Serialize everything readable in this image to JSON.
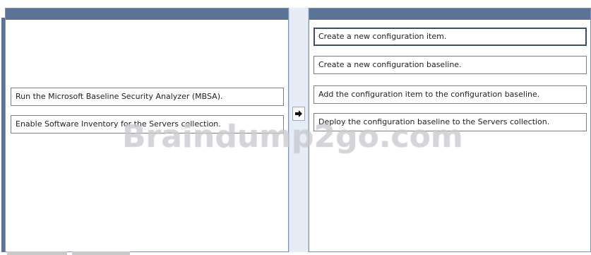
{
  "source_items": [
    "Run the Microsoft Baseline Security Analyzer (MBSA).",
    "Enable Software Inventory for the Servers collection."
  ],
  "target_items": [
    "Create a new configuration item.",
    "Create a new configuration baseline.",
    "Add the configuration item to the configuration baseline.",
    "Deploy the configuration baseline to the Servers collection."
  ],
  "watermark": "Braindump2go.com",
  "colors": {
    "header": "#5b7396",
    "border": "#7f95b3"
  },
  "icons": {
    "move_button": "right-arrow-icon"
  }
}
